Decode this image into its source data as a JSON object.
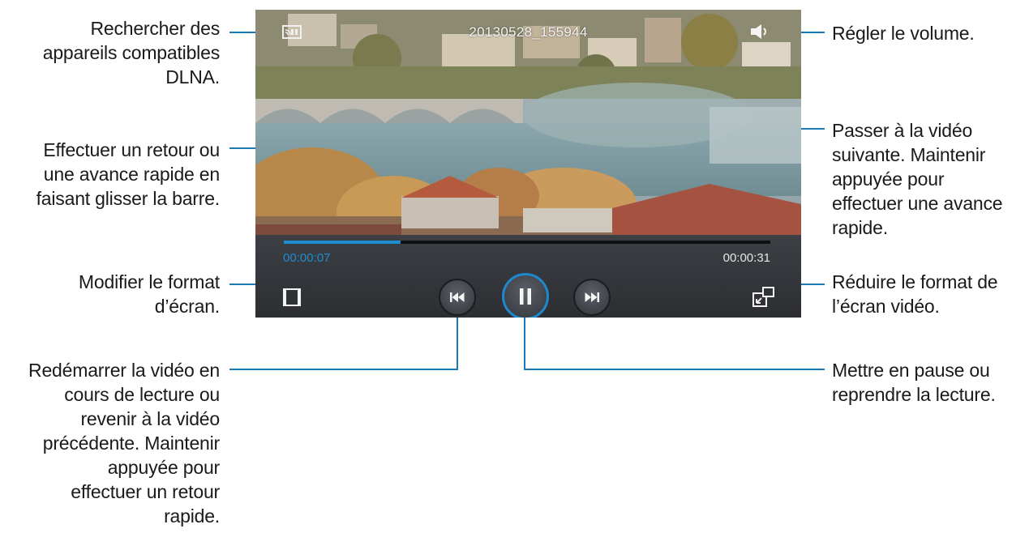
{
  "player": {
    "video_title": "20130528_155944",
    "elapsed_time": "00:00:07",
    "total_time": "00:00:31",
    "progress": 0.24,
    "accent_color": "#1f8dd1"
  },
  "icons": {
    "dlna": "dlna-cast-icon",
    "volume": "speaker-icon",
    "aspect_ratio": "screen-format-icon",
    "previous": "previous-track-icon",
    "pause": "pause-icon",
    "next": "next-track-icon",
    "popup": "pop-up-play-icon"
  },
  "callouts": {
    "dlna": "Rechercher des\nappareils compatibles\nDLNA.",
    "volume": "Régler le volume.",
    "seek": "Effectuer un retour ou\nune avance rapide en\nfaisant glisser la barre.",
    "next": "Passer à la vidéo\nsuivante. Maintenir\nappuyée pour\neffectuer une avance\nrapide.",
    "aspect": "Modifier le format\nd’écran.",
    "popup": "Réduire le format de\nl’écran vidéo.",
    "previous": "Redémarrer la vidéo en\ncours de lecture ou\nrevenir à la vidéo\nprécédente. Maintenir\nappuyée pour\neffectuer un retour\nrapide.",
    "pause": "Mettre en pause ou\nreprendre la lecture."
  }
}
